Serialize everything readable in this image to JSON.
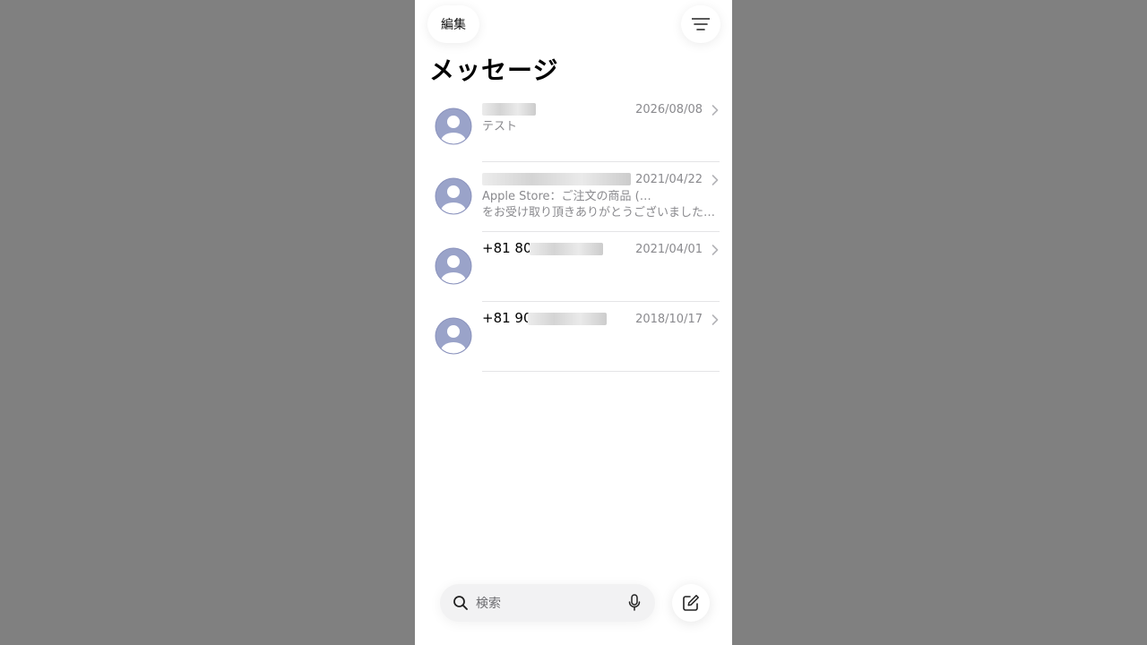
{
  "header": {
    "edit_label": "編集",
    "filter_icon": "filter-lines-icon",
    "title": "メッセージ"
  },
  "messages": [
    {
      "name": "",
      "date": "2026/08/08",
      "preview_line1": "テスト",
      "preview_line2": ""
    },
    {
      "name": "",
      "date": "2021/04/22",
      "preview_line1": "Apple Store：ご注文の商品 (",
      "preview_line1_end": ")",
      "preview_line2": "をお受け取り頂きありがとうございました。…"
    },
    {
      "name": "+81 80",
      "date": "2021/04/01",
      "preview_line1": "",
      "preview_line2": ""
    },
    {
      "name": "+81 90",
      "date": "2018/10/17",
      "preview_line1": "",
      "preview_line2": ""
    }
  ],
  "search": {
    "placeholder": "検索",
    "search_icon": "search-icon",
    "mic_icon": "microphone-icon"
  },
  "compose": {
    "icon": "compose-icon"
  },
  "colors": {
    "background": "#808080",
    "avatar": "#9aa3c9",
    "secondary_text": "#8a8a8e"
  }
}
